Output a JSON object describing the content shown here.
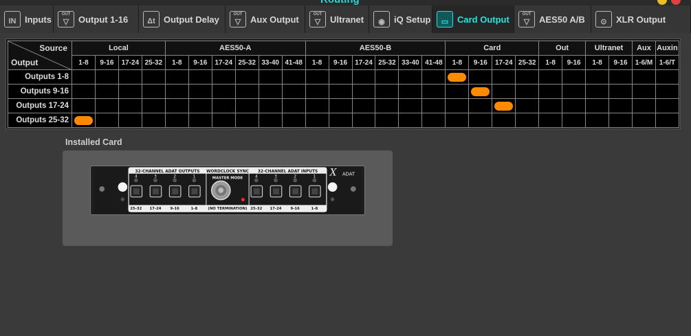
{
  "window": {
    "title": "Routing"
  },
  "tabs": [
    {
      "label": "Inputs",
      "icon": "input-in-icon",
      "top": "",
      "glyph": "IN",
      "width": 78,
      "active": false
    },
    {
      "label": "Output 1-16",
      "icon": "output-out-icon",
      "top": "OUT",
      "glyph": "▽",
      "width": 124,
      "active": false
    },
    {
      "label": "Output Delay",
      "icon": "delay-icon",
      "top": "",
      "glyph": "Δt",
      "width": 126,
      "active": false
    },
    {
      "label": "Aux Output",
      "icon": "aux-out-icon",
      "top": "OUT",
      "glyph": "▽",
      "width": 116,
      "active": false
    },
    {
      "label": "Ultranet",
      "icon": "ultranet-out-icon",
      "top": "OUT",
      "glyph": "▽",
      "width": 93,
      "active": false
    },
    {
      "label": "iQ Setup",
      "icon": "speaker-icon",
      "top": "",
      "glyph": "◉",
      "width": 92,
      "active": false
    },
    {
      "label": "Card Output",
      "icon": "card-icon",
      "top": "",
      "glyph": "▭",
      "width": 119,
      "active": true
    },
    {
      "label": "AES50 A/B",
      "icon": "aes50-out-icon",
      "top": "OUT",
      "glyph": "▽",
      "width": 112,
      "active": false
    },
    {
      "label": "XLR Output",
      "icon": "xlr-icon",
      "top": "",
      "glyph": "⊙",
      "width": 145,
      "active": false
    }
  ],
  "matrix": {
    "corner_source": "Source",
    "corner_output": "Output",
    "groups": [
      {
        "label": "Local",
        "cols": [
          "1-8",
          "9-16",
          "17-24",
          "25-32"
        ]
      },
      {
        "label": "AES50-A",
        "cols": [
          "1-8",
          "9-16",
          "17-24",
          "25-32",
          "33-40",
          "41-48"
        ]
      },
      {
        "label": "AES50-B",
        "cols": [
          "1-8",
          "9-16",
          "17-24",
          "25-32",
          "33-40",
          "41-48"
        ]
      },
      {
        "label": "Card",
        "cols": [
          "1-8",
          "9-16",
          "17-24",
          "25-32"
        ]
      },
      {
        "label": "Out",
        "cols": [
          "1-8",
          "9-16"
        ]
      },
      {
        "label": "Ultranet",
        "cols": [
          "1-8",
          "9-16"
        ]
      },
      {
        "label": "Aux",
        "cols": [
          "1-6/M"
        ]
      },
      {
        "label": "Auxin",
        "cols": [
          "1-6/T"
        ]
      }
    ],
    "rows": [
      {
        "label": "Outputs 1-8",
        "selected_col": 16
      },
      {
        "label": "Outputs 9-16",
        "selected_col": 17
      },
      {
        "label": "Outputs 17-24",
        "selected_col": 18
      },
      {
        "label": "Outputs 25-32",
        "selected_col": 0
      }
    ],
    "selected_color": "#ff8a00"
  },
  "installed_card": {
    "label": "Installed Card",
    "outputs_title": "32-CHANNEL ADAT OUTPUTS",
    "wordclock_title": "WORDCLOCK SYNC",
    "inputs_title": "32-CHANNEL ADAT INPUTS",
    "master_mode": "MASTER MODE",
    "no_termination": "(NO TERMINATION)",
    "brand": "ADAT",
    "brand_mark": "X",
    "output_ports": [
      {
        "num": "4",
        "range": "25-32"
      },
      {
        "num": "3",
        "range": "17-24"
      },
      {
        "num": "2",
        "range": "9-16"
      },
      {
        "num": "1",
        "range": "1-8"
      }
    ],
    "input_ports": [
      {
        "num": "4",
        "range": "25-32"
      },
      {
        "num": "3",
        "range": "17-24"
      },
      {
        "num": "2",
        "range": "9-16"
      },
      {
        "num": "1",
        "range": "1-8"
      }
    ]
  },
  "colors": {
    "accent": "#2fe0e0",
    "background": "#3a3a3a"
  }
}
